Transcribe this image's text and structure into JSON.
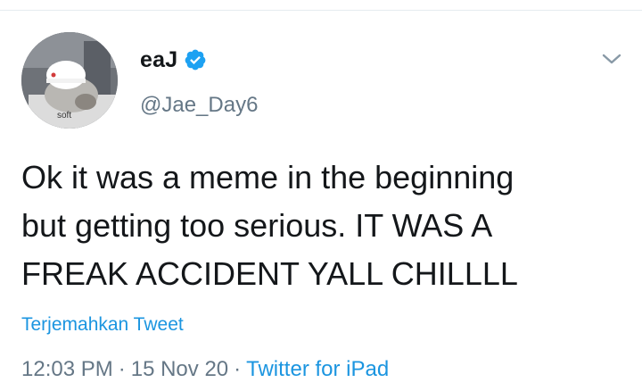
{
  "tweet": {
    "display_name": "eaJ",
    "handle": "@Jae_Day6",
    "avatar_caption": "soft",
    "text": "Ok it was a meme in the beginning\nbut getting too serious. IT WAS A\nFREAK ACCIDENT YALL CHILLLL",
    "translate_label": "Terjemahkan Tweet",
    "time": "12:03 PM",
    "separator": "·",
    "date": "15 Nov 20",
    "source": "Twitter for iPad"
  },
  "icons": {
    "verified": "verified-badge-icon",
    "more": "chevron-down-icon"
  },
  "colors": {
    "text": "#14171a",
    "secondary": "#657786",
    "link": "#1b95e0",
    "verified": "#1da1f2"
  }
}
